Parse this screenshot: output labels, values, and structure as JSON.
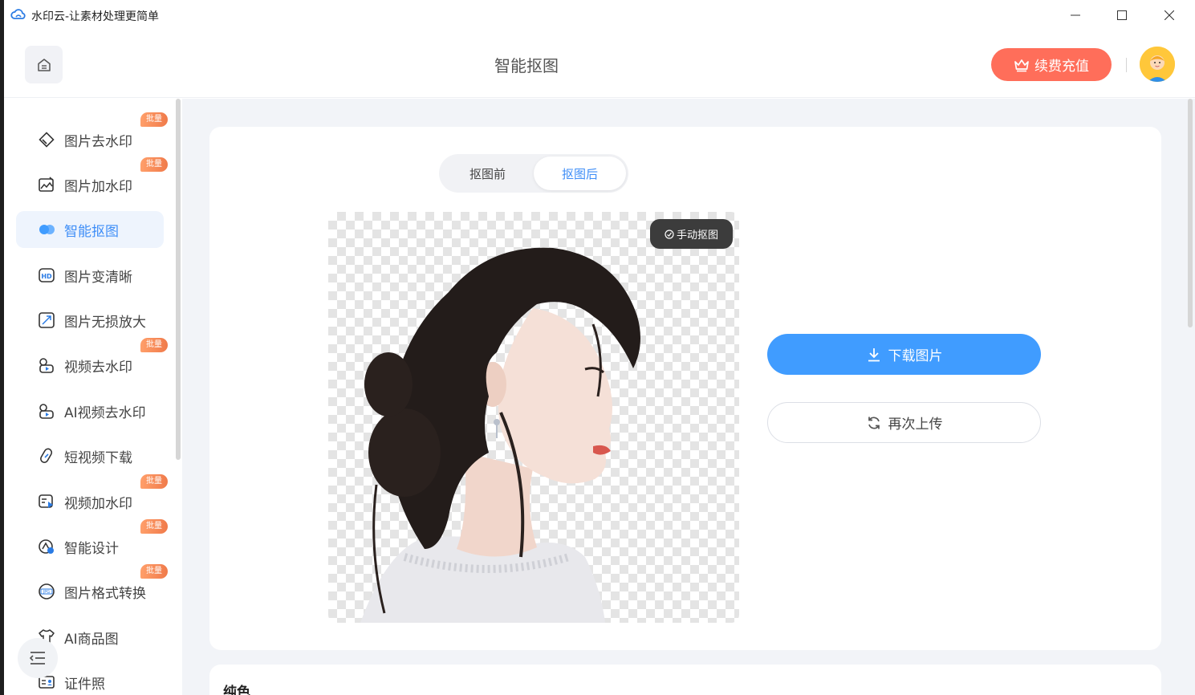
{
  "window": {
    "title": "水印云-让素材处理更简单",
    "controls": {
      "minimize": "minimize-icon",
      "maximize": "maximize-icon",
      "close": "close-icon"
    }
  },
  "header": {
    "page_title": "智能抠图",
    "vip_label": "续费充值",
    "home_icon": "home-icon",
    "vip_icon": "crown-icon"
  },
  "sidebar": {
    "items": [
      {
        "label": "图片去水印",
        "badge": "批量",
        "icon": "eraser-icon"
      },
      {
        "label": "图片加水印",
        "badge": "批量",
        "icon": "image-edit-icon"
      },
      {
        "label": "智能抠图",
        "badge": "",
        "icon": "cutout-icon",
        "active": true
      },
      {
        "label": "图片变清晰",
        "badge": "",
        "icon": "hd-icon"
      },
      {
        "label": "图片无损放大",
        "badge": "",
        "icon": "enlarge-icon"
      },
      {
        "label": "视频去水印",
        "badge": "批量",
        "icon": "video-eraser-icon"
      },
      {
        "label": "AI视频去水印",
        "badge": "",
        "icon": "ai-video-eraser-icon"
      },
      {
        "label": "短视频下载",
        "badge": "",
        "icon": "link-icon"
      },
      {
        "label": "视频加水印",
        "badge": "批量",
        "icon": "video-add-icon"
      },
      {
        "label": "智能设计",
        "badge": "批量",
        "icon": "design-icon"
      },
      {
        "label": "图片格式转换",
        "badge": "批量",
        "icon": "jpg-icon"
      },
      {
        "label": "AI商品图",
        "badge": "",
        "icon": "shirt-icon"
      },
      {
        "label": "证件照",
        "badge": "",
        "icon": "id-card-icon"
      }
    ],
    "collapse_icon": "menu-collapse-icon"
  },
  "main": {
    "toggle": {
      "before": "抠图前",
      "after": "抠图后",
      "selected": "抠图后"
    },
    "manual_label": "手动抠图",
    "download_label": "下载图片",
    "reupload_label": "再次上传",
    "section_title": "纯色"
  },
  "colors": {
    "accent": "#409cff",
    "active_text": "#3f8ef7",
    "vip": "#ff6e5a",
    "badge": "#f07a4a",
    "background": "#f2f4f8"
  }
}
